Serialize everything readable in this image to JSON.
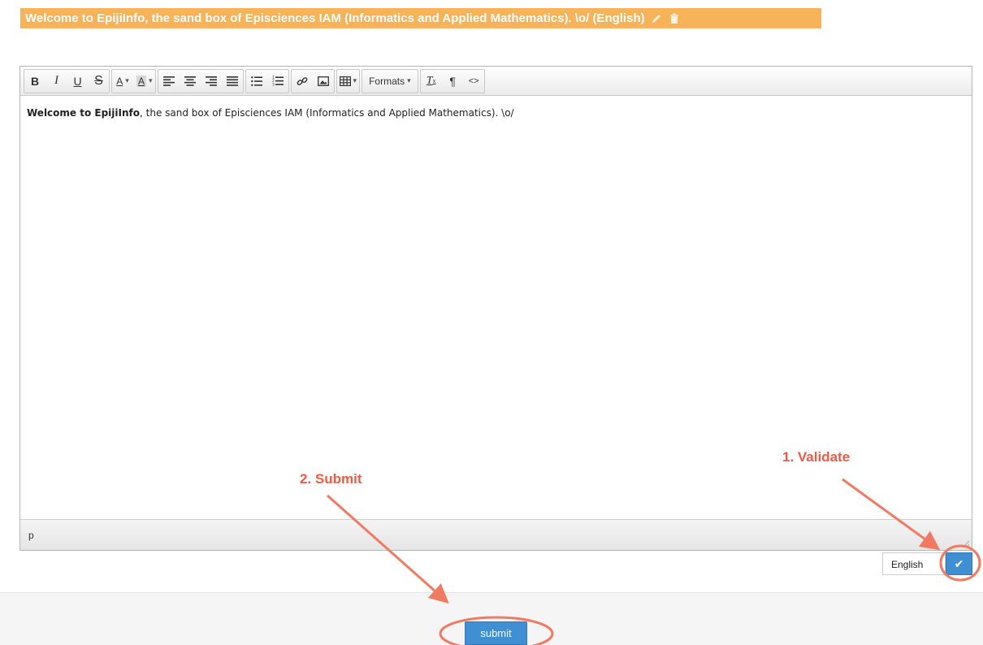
{
  "banner": {
    "title": "Welcome to EpijiInfo, the sand box of Episciences IAM (Informatics and Applied Mathematics). \\o/ (English)",
    "icons": [
      "pencil-icon",
      "trash-icon"
    ]
  },
  "toolbar": {
    "bold": "B",
    "italic": "I",
    "underline": "U",
    "strike": "S",
    "text_color": "A",
    "bg_color": "A",
    "formats": "Formats",
    "clear_format": "T",
    "paragraph": "¶",
    "source": "<>"
  },
  "content": {
    "bold_part": "Welcome to EpijiInfo",
    "rest": ", the sand box of Episciences IAM (Informatics and Applied Mathematics). \\o/"
  },
  "statusbar": {
    "path": "p"
  },
  "language": {
    "selected": "English"
  },
  "validate": {
    "icon": "✔"
  },
  "submit": {
    "label": "submit"
  },
  "annotations": {
    "step1": "1. Validate",
    "step2": "2. Submit"
  },
  "colors": {
    "banner": "#f5b35a",
    "button_blue": "#3f8fd2",
    "annotation_red": "#f05a45"
  }
}
